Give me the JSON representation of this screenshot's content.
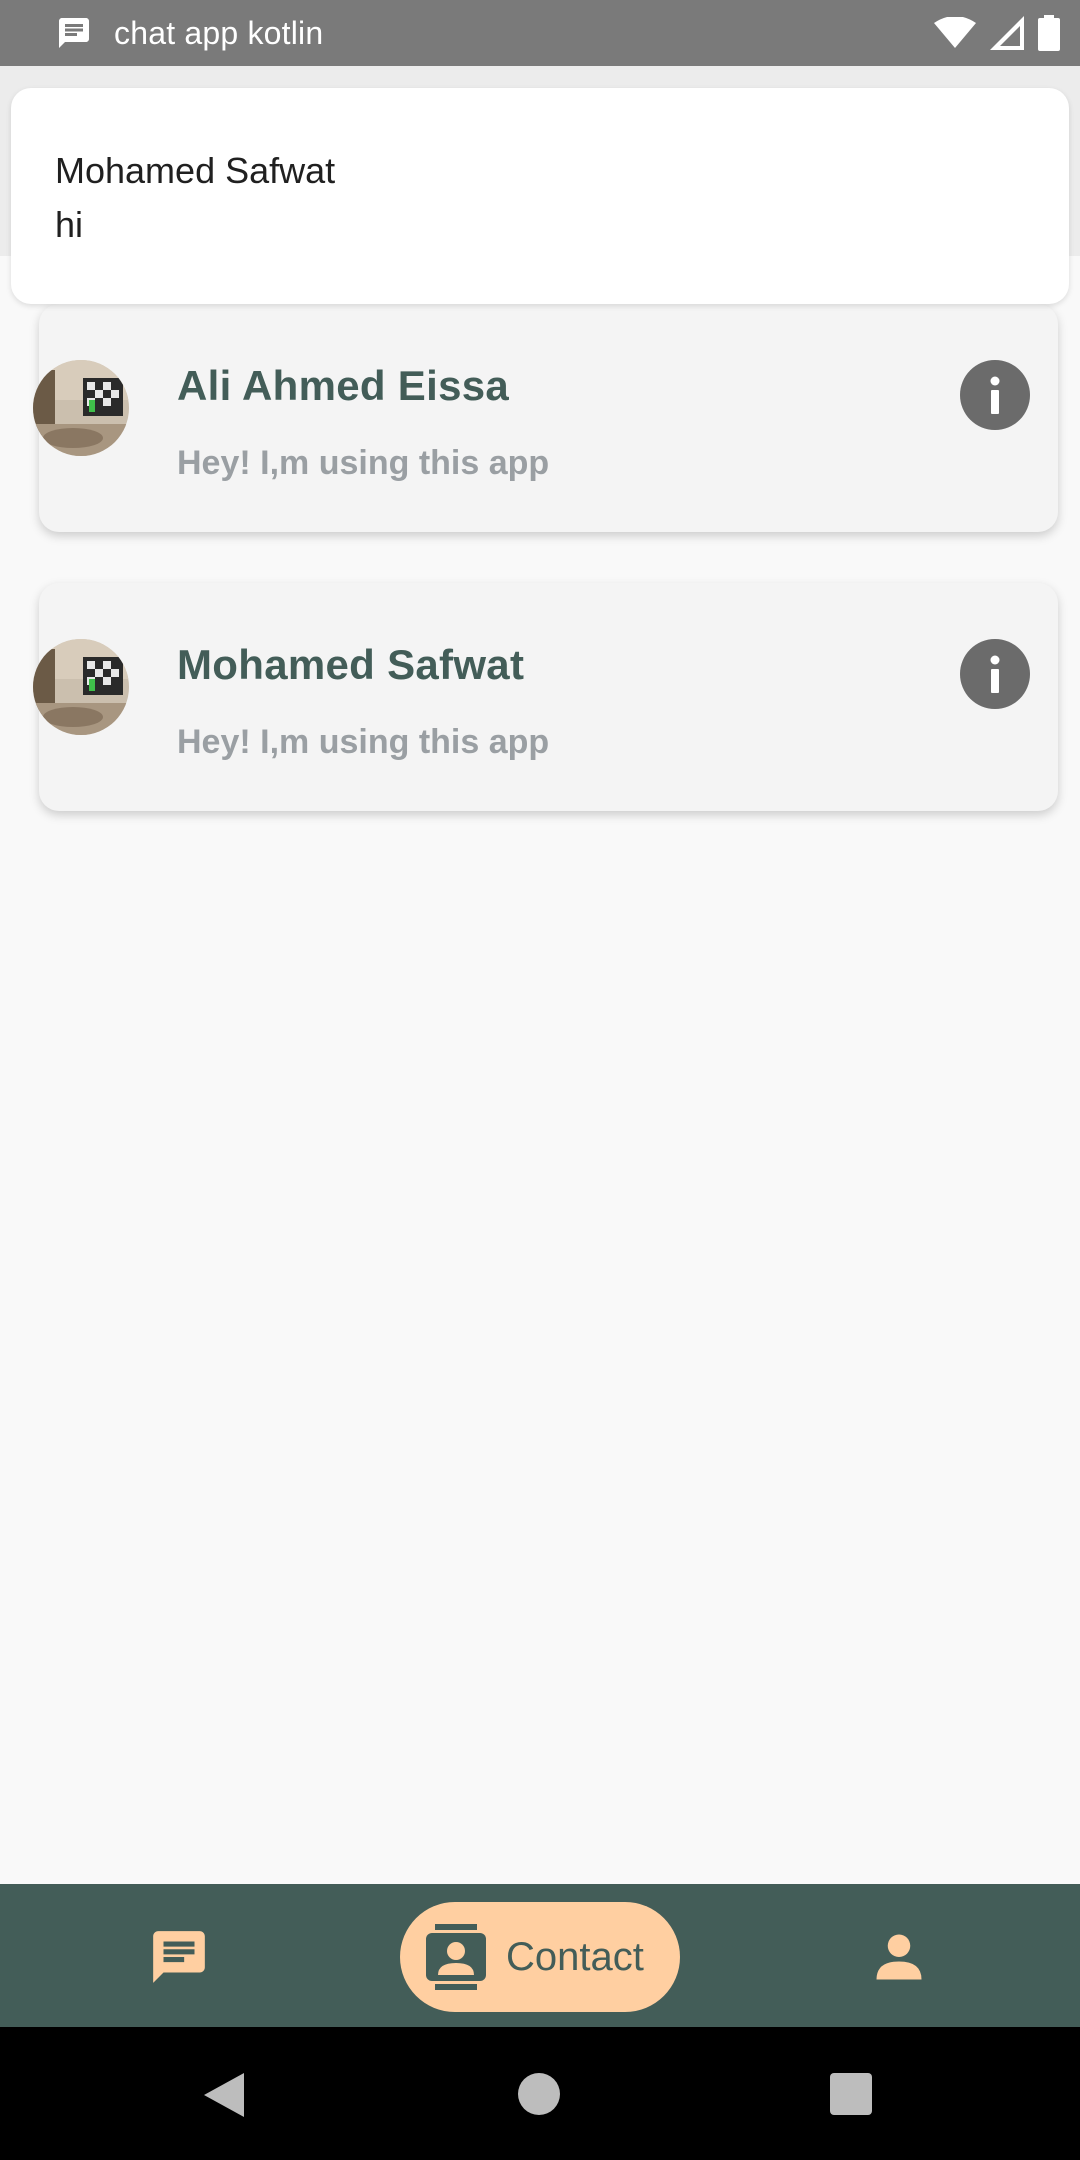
{
  "status_bar": {
    "title": "chat app kotlin",
    "icons": [
      "message-icon",
      "wifi-icon",
      "signal-icon",
      "battery-icon"
    ]
  },
  "notification": {
    "sender": "Mohamed Safwat",
    "message": "hi"
  },
  "contacts": [
    {
      "name": "Ali Ahmed Eissa",
      "status": "Hey! I,m using this app",
      "avatar_icon": "profile-photo",
      "action_icon": "info-icon"
    },
    {
      "name": "Mohamed Safwat",
      "status": "Hey! I,m using this app",
      "avatar_icon": "profile-photo",
      "action_icon": "info-icon"
    }
  ],
  "bottom_nav": {
    "items": [
      {
        "id": "chats",
        "icon": "chat-icon",
        "label": "",
        "selected": false
      },
      {
        "id": "contact",
        "icon": "contacts-icon",
        "label": "Contact",
        "selected": true
      },
      {
        "id": "profile",
        "icon": "person-icon",
        "label": "",
        "selected": false
      }
    ]
  },
  "system_nav": {
    "icons": [
      "back-icon",
      "home-icon",
      "recents-icon"
    ]
  },
  "colors": {
    "status_bar": "#7a7a7a",
    "primary_dark_green": "#435d58",
    "accent_peach": "#ffcfa1",
    "card_bg": "#f4f4f4",
    "subtitle_gray": "#9a9fa3",
    "info_icon_gray": "#6b6b6b"
  }
}
